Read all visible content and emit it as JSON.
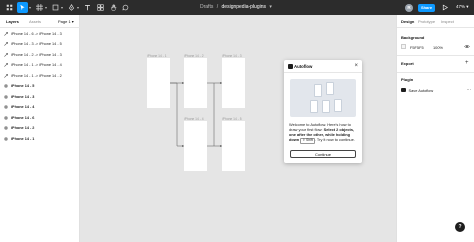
{
  "toolbar": {
    "breadcrumb_project": "Drafts",
    "breadcrumb_separator": "/",
    "file_name": "designpedia-plugins",
    "avatar_initial": "R",
    "share_label": "Share",
    "zoom": "47%"
  },
  "left_panel": {
    "tab_layers": "Layers",
    "tab_assets": "Assets",
    "page_selector": "Page 1",
    "layers": [
      {
        "label": "iPhone 14 - 6 -> iPhone 14 - 3",
        "kind": "connector"
      },
      {
        "label": "iPhone 14 - 3 -> iPhone 14 - 5",
        "kind": "connector"
      },
      {
        "label": "iPhone 14 - 2 -> iPhone 14 - 3",
        "kind": "connector"
      },
      {
        "label": "iPhone 14 - 1 -> iPhone 14 - 4",
        "kind": "connector"
      },
      {
        "label": "iPhone 14 - 1 -> iPhone 14 - 2",
        "kind": "connector"
      },
      {
        "label": "iPhone 14 - 5",
        "kind": "frame"
      },
      {
        "label": "iPhone 14 - 3",
        "kind": "frame"
      },
      {
        "label": "iPhone 14 - 4",
        "kind": "frame"
      },
      {
        "label": "iPhone 14 - 6",
        "kind": "frame"
      },
      {
        "label": "iPhone 14 - 2",
        "kind": "frame"
      },
      {
        "label": "iPhone 14 - 1",
        "kind": "frame"
      }
    ]
  },
  "canvas": {
    "frames": [
      {
        "label": "iPhone 14 - 1"
      },
      {
        "label": "iPhone 14 - 2"
      },
      {
        "label": "iPhone 14 - 3"
      },
      {
        "label": "iPhone 14 - 4"
      },
      {
        "label": "iPhone 14 - 5"
      }
    ]
  },
  "modal": {
    "title": "Autoflow",
    "text_intro": "Welcome to Autoflow. Here's how to draw your first flow:",
    "text_bold": "Select 2 objects, one after the other, while holding down",
    "key": "⇧ Shift",
    "text_end": ". Try it now to continue.",
    "continue_label": "Continue"
  },
  "right_panel": {
    "tab_design": "Design",
    "tab_prototype": "Prototype",
    "tab_inspect": "Inspect",
    "background_label": "Background",
    "bg_hex": "F5F5F5",
    "bg_opacity": "100%",
    "export_label": "Export",
    "plugin_label": "Plugin",
    "plugin_name": "Save Autoflow"
  },
  "help_label": "?",
  "colors": {
    "toolbar_bg": "#2c2c2c",
    "accent": "#0d99ff",
    "canvas_bg": "#e5e5e5",
    "frame_fill": "#ffffff"
  }
}
